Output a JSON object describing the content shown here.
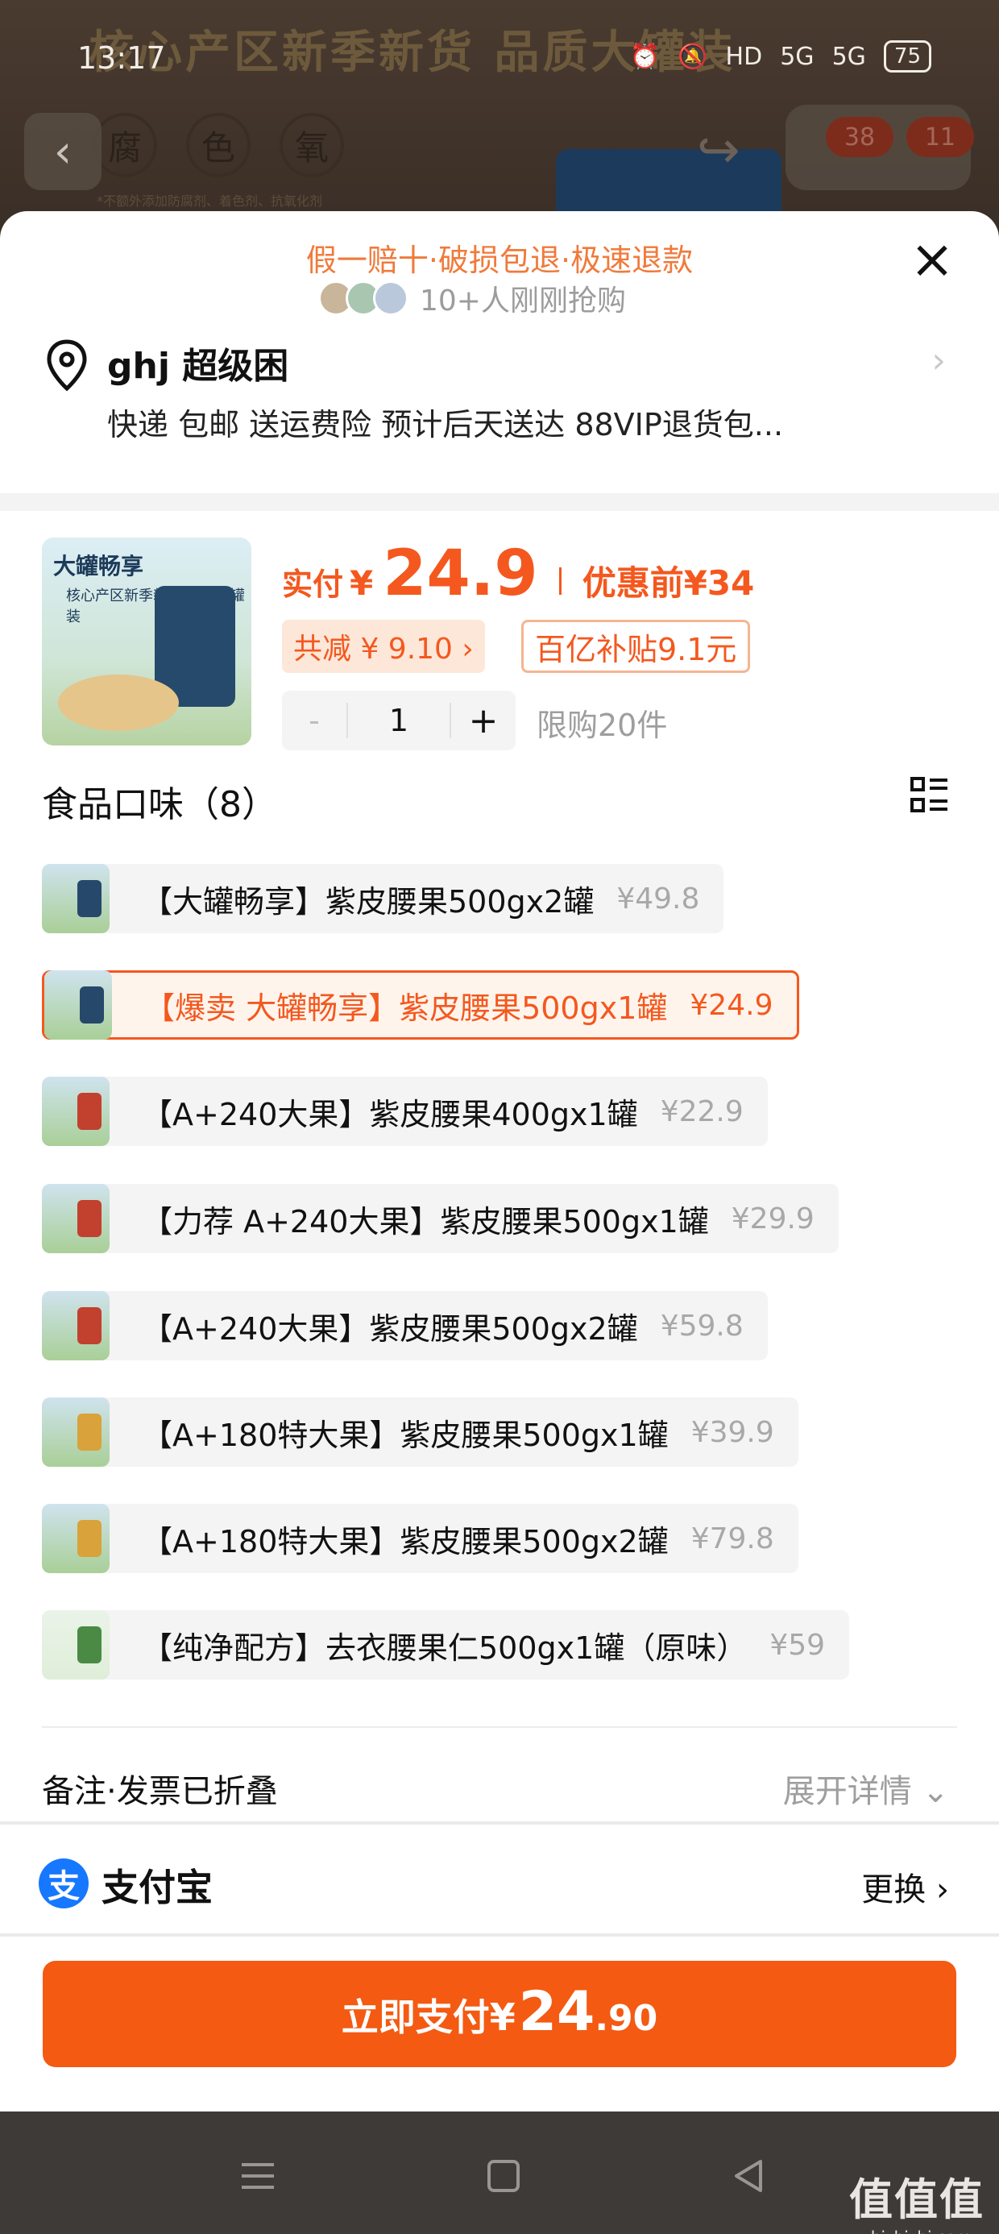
{
  "status_bar": {
    "time": "13:17",
    "network1": "HD",
    "network2": "5G",
    "network3": "5G",
    "battery": "75"
  },
  "background": {
    "headline": "核心产区新季新货 品质大罐装",
    "badges": [
      "腐",
      "色",
      "氧"
    ],
    "note": "*不额外添加防腐剂、着色剂、抗氧化剂",
    "cart_count": "38",
    "more_count": "11"
  },
  "sheet": {
    "promo": "假一赔十·破损包退·极速退款",
    "joiners": "10+人刚刚抢购",
    "address": {
      "name": "ghj 超级困",
      "shipping": "快递 包邮 送运费险 预计后天送达 88VIP退货包..."
    },
    "product": {
      "thumb_title": "大罐畅享",
      "thumb_sub": "核心产区新季新货 品质大罐装",
      "price_label": "实付",
      "price_currency": "¥",
      "price_value": "24.9",
      "before_price": "优惠前¥34",
      "discount": "共减 ¥ 9.10 ›",
      "subsidy": "百亿补贴9.1元",
      "qty_minus": "-",
      "quantity": "1",
      "qty_plus": "+",
      "limit": "限购20件"
    },
    "flavor_title": "食品口味（8）",
    "options": [
      {
        "name": "【大罐畅享】紫皮腰果500gx2罐",
        "price": "¥49.8",
        "selected": false
      },
      {
        "name": "【爆卖 大罐畅享】紫皮腰果500gx1罐",
        "price": "¥24.9",
        "selected": true
      },
      {
        "name": "【A+240大果】紫皮腰果400gx1罐",
        "price": "¥22.9",
        "selected": false
      },
      {
        "name": "【力荐 A+240大果】紫皮腰果500gx1罐",
        "price": "¥29.9",
        "selected": false
      },
      {
        "name": "【A+240大果】紫皮腰果500gx2罐",
        "price": "¥59.8",
        "selected": false
      },
      {
        "name": "【A+180特大果】紫皮腰果500gx1罐",
        "price": "¥39.9",
        "selected": false
      },
      {
        "name": "【A+180特大果】紫皮腰果500gx2罐",
        "price": "¥79.8",
        "selected": false
      },
      {
        "name": "【纯净配方】去衣腰果仁500gx1罐（原味）",
        "price": "¥59",
        "selected": false
      }
    ],
    "notes_label": "备注·发票已折叠",
    "expand_label": "展开详情",
    "payment": {
      "icon_char": "支",
      "method": "支付宝",
      "change_label": "更换 ›"
    },
    "pay_button": {
      "label": "立即支付¥",
      "amount_int": "24",
      "amount_dec": ".90"
    }
  },
  "watermark": {
    "big": "值值值",
    "small": "zhizhizhi.com"
  },
  "colors": {
    "accent": "#f4581e",
    "promo": "#f07a3b",
    "button": "#f45a12",
    "alipay": "#1677ff"
  }
}
